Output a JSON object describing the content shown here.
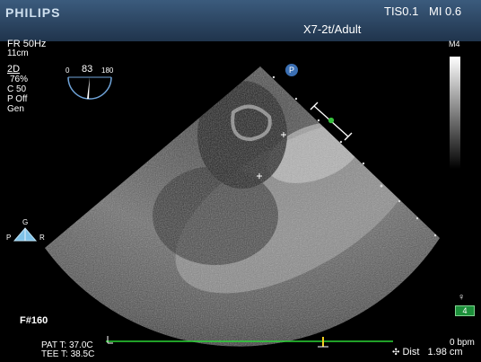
{
  "header": {
    "brand": "PHILIPS",
    "tis": "TIS0.1",
    "mi": "MI 0.6",
    "probe": "X7-2t/Adult"
  },
  "left_panel": {
    "frame_rate": "FR 50Hz",
    "depth": "11cm",
    "mode": "2D",
    "gain": "76%",
    "compression": "C 50",
    "power": "P Off",
    "preset": "Gen",
    "frame_number": "F#160"
  },
  "angle_indicator": {
    "min": "0",
    "value": "83",
    "max": "180"
  },
  "grayscale_label": "M4",
  "position_marker": "P",
  "orientation": {
    "top": "G",
    "left": "P",
    "right": "R"
  },
  "marker_badge": "4",
  "temperatures": {
    "patient": "PAT T: 37.0C",
    "tee": "TEE T: 38.5C"
  },
  "measurement": {
    "label": "Dist",
    "value": "1.98 cm"
  },
  "heart_rate": "0 bpm",
  "colors": {
    "header_top": "#3b5b7d",
    "header_bottom": "#20344c",
    "ecg_line": "#2bd636",
    "measure_marker": "#38c23e"
  },
  "icons": [
    "p-position-icon",
    "orientation-icon",
    "caliper-icon",
    "ecg-trace-icon"
  ]
}
